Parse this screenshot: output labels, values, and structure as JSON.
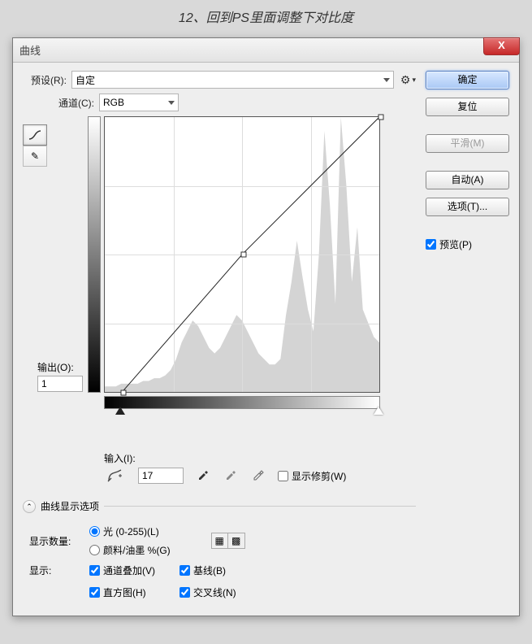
{
  "caption": "12、回到PS里面调整下对比度",
  "window": {
    "title": "曲线",
    "close": "X"
  },
  "preset": {
    "label": "预设(R):",
    "value": "自定"
  },
  "channel": {
    "label": "通道(C):",
    "value": "RGB"
  },
  "output": {
    "label": "输出(O):",
    "value": "1"
  },
  "input": {
    "label": "输入(I):",
    "value": "17"
  },
  "show_clip": "显示修剪(W)",
  "disclosure": "曲线显示选项",
  "display_qty": {
    "label": "显示数量:",
    "opt_light": "光 (0-255)(L)",
    "opt_pigment": "颜料/油墨 %(G)"
  },
  "show": {
    "label": "显示:",
    "channel_overlay": "通道叠加(V)",
    "baseline": "基线(B)",
    "histogram": "直方图(H)",
    "intersection": "交叉线(N)"
  },
  "buttons": {
    "ok": "确定",
    "reset": "复位",
    "smooth": "平滑(M)",
    "auto": "自动(A)",
    "options": "选项(T)...",
    "preview": "预览(P)"
  },
  "chart_data": {
    "type": "line",
    "title": "曲线",
    "xlabel": "输入",
    "ylabel": "输出",
    "xlim": [
      0,
      255
    ],
    "ylim": [
      0,
      255
    ],
    "curve_points": [
      {
        "x": 17,
        "y": 1
      },
      {
        "x": 128,
        "y": 128
      },
      {
        "x": 255,
        "y": 255
      }
    ],
    "histogram_approx": [
      2,
      2,
      2,
      3,
      3,
      3,
      3,
      4,
      4,
      5,
      5,
      6,
      8,
      12,
      18,
      22,
      26,
      24,
      20,
      16,
      14,
      16,
      20,
      24,
      28,
      26,
      22,
      18,
      14,
      12,
      10,
      10,
      12,
      28,
      40,
      55,
      42,
      30,
      22,
      50,
      95,
      68,
      32,
      100,
      75,
      40,
      60,
      30,
      25,
      20,
      18
    ]
  }
}
